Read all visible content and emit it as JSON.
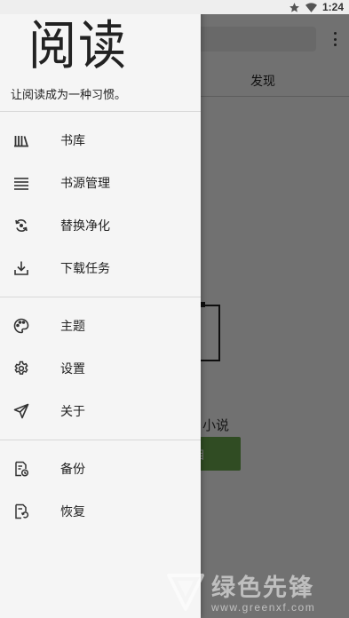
{
  "status_bar": {
    "time": "1:24",
    "icons": [
      "star-icon",
      "wifi-icon"
    ]
  },
  "background": {
    "tab_label": "发现",
    "empty_text": "小说",
    "button_fragment": "目",
    "accent_color": "#6aa84f"
  },
  "drawer": {
    "logo": "阅读",
    "tagline": "让阅读成为一种习惯。",
    "groups": [
      [
        {
          "icon": "bookshelf-icon",
          "label": "书库"
        },
        {
          "icon": "list-icon",
          "label": "书源管理"
        },
        {
          "icon": "replace-icon",
          "label": "替换净化"
        },
        {
          "icon": "download-icon",
          "label": "下载任务"
        }
      ],
      [
        {
          "icon": "palette-icon",
          "label": "主题"
        },
        {
          "icon": "settings-icon",
          "label": "设置"
        },
        {
          "icon": "send-icon",
          "label": "关于"
        }
      ],
      [
        {
          "icon": "backup-icon",
          "label": "备份"
        },
        {
          "icon": "restore-icon",
          "label": "恢复"
        }
      ]
    ]
  },
  "watermark": {
    "name": "绿色先锋",
    "url": "www.greenxf.com"
  }
}
